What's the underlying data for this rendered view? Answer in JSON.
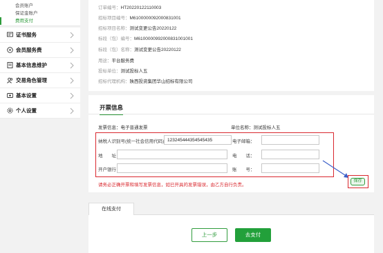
{
  "sidebar": {
    "sub_items": [
      {
        "label": "会员账户"
      },
      {
        "label": "保证金账户"
      },
      {
        "label": "费用支付"
      }
    ],
    "items": [
      {
        "label": "证书服务",
        "icon": "certificate-icon"
      },
      {
        "label": "会员服务费",
        "icon": "member-icon"
      },
      {
        "label": "基本信息维护",
        "icon": "document-icon"
      },
      {
        "label": "交易角色管理",
        "icon": "users-icon"
      },
      {
        "label": "基本设置",
        "icon": "settings-icon"
      },
      {
        "label": "个人设置",
        "icon": "gear-icon"
      }
    ]
  },
  "order_info": {
    "order_no": {
      "label": "订单编号：",
      "value": "HT20220122110003"
    },
    "project_no": {
      "label": "招标项目编号：",
      "value": "M6100000092000831001"
    },
    "project_name": {
      "label": "招标项目名称：",
      "value": "测试变更公告20220122"
    },
    "section_no": {
      "label": "标段（包）编号：",
      "value": "M6100000992000831001001"
    },
    "section_name": {
      "label": "标段（包）名称：",
      "value": "测试变更公告20220122"
    },
    "purpose": {
      "label": "用途：",
      "value": "平台服务费"
    },
    "bidder": {
      "label": "投标单位：",
      "value": "测试投标人五"
    },
    "agency": {
      "label": "招标代理机构：",
      "value": "陕西投资集团华山招标有限公司"
    }
  },
  "invoice": {
    "title": "开票信息",
    "type_label": "发票信息：电子普通发票",
    "company_label": "单位名称：测试投标人五",
    "fields": {
      "tax_id": {
        "label": "纳税人识别号(统一社会信用代码)：",
        "value": "123245444354545435"
      },
      "email": {
        "label": "电子邮箱：",
        "value": ""
      },
      "address": {
        "label": "地　　址：",
        "value": ""
      },
      "phone": {
        "label": "电　　话：",
        "value": ""
      },
      "bank": {
        "label": "开户银行：",
        "value": ""
      },
      "account": {
        "label": "账　　号：",
        "value": ""
      }
    },
    "warning": "请务必正确开票和填写发票信息，如已开具的发票错误，由乙方自行负责。",
    "save_label": "保存"
  },
  "payment": {
    "tab_label": "在线支付",
    "prev_label": "上一步",
    "pay_label": "去支付"
  },
  "colors": {
    "accent": "#2e9b3b",
    "warning": "#d9262c",
    "pay_button": "#22a03a"
  }
}
